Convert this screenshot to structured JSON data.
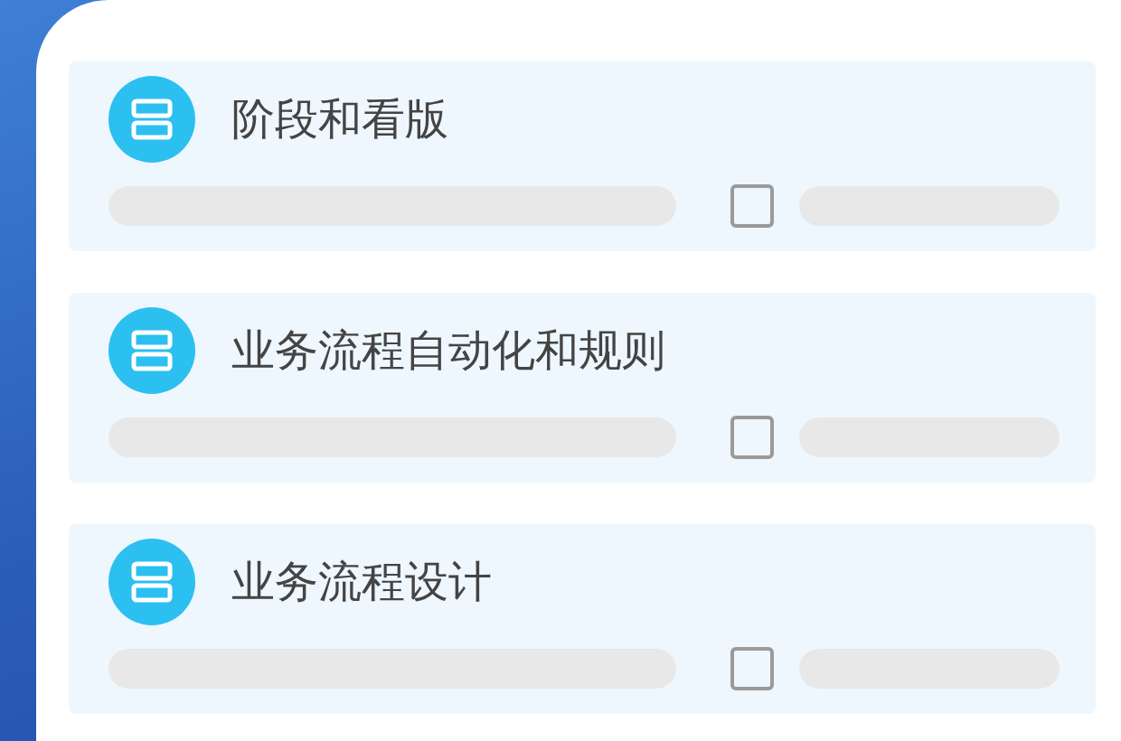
{
  "items": [
    {
      "title": "阶段和看版",
      "checked": false
    },
    {
      "title": "业务流程自动化和规则",
      "checked": false
    },
    {
      "title": "业务流程设计",
      "checked": false
    }
  ]
}
